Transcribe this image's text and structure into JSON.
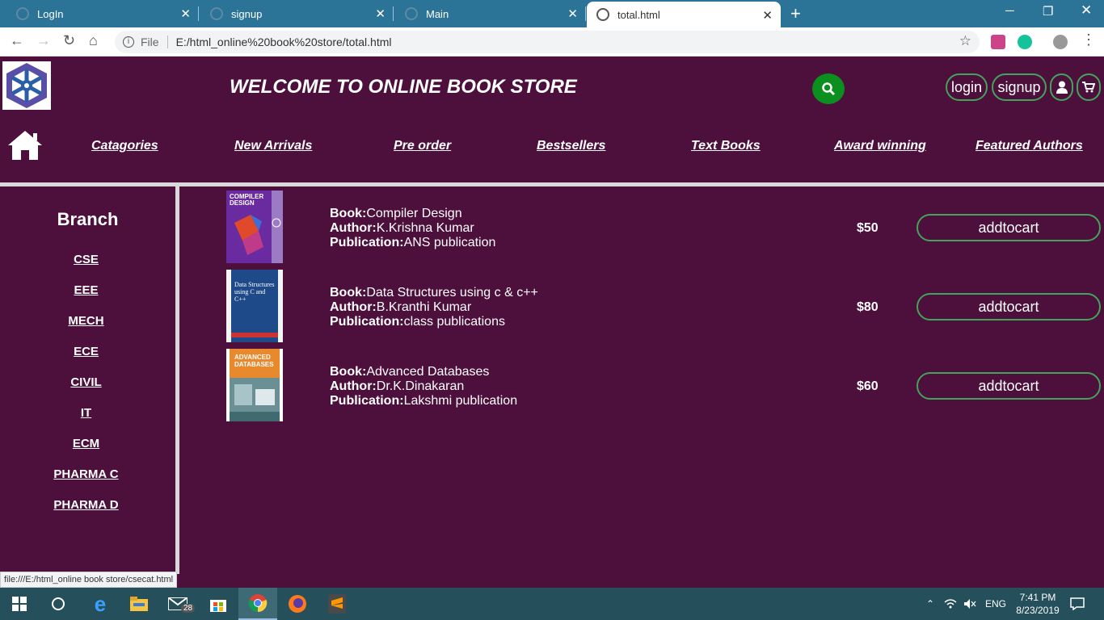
{
  "browser": {
    "tabs": [
      {
        "title": "LogIn"
      },
      {
        "title": "signup"
      },
      {
        "title": "Main"
      },
      {
        "title": "total.html"
      }
    ],
    "address": {
      "file_label": "File",
      "url": "E:/html_online%20book%20store/total.html"
    },
    "status_url": "file:///E:/html_online book store/csecat.html"
  },
  "header": {
    "title": "WELCOME TO ONLINE BOOK STORE",
    "login_label": "login",
    "signup_label": "signup"
  },
  "nav": {
    "items": [
      {
        "label": "Catagories"
      },
      {
        "label": "New Arrivals"
      },
      {
        "label": "Pre order"
      },
      {
        "label": "Bestsellers"
      },
      {
        "label": "Text Books"
      },
      {
        "label": "Award winning"
      },
      {
        "label": "Featured Authors"
      }
    ]
  },
  "sidebar": {
    "title": "Branch",
    "branches": [
      {
        "label": "CSE"
      },
      {
        "label": "EEE"
      },
      {
        "label": "MECH"
      },
      {
        "label": "ECE"
      },
      {
        "label": "CIVIL"
      },
      {
        "label": "IT"
      },
      {
        "label": "ECM"
      },
      {
        "label": "PHARMA C"
      },
      {
        "label": "PHARMA D"
      }
    ]
  },
  "books": {
    "field_labels": {
      "book": "Book:",
      "author": "Author:",
      "publication": "Publication:"
    },
    "add_label": "addtocart",
    "items": [
      {
        "book": "Compiler Design",
        "author": "K.Krishna Kumar",
        "publication": "ANS publication",
        "price": "$50",
        "cover_text": "COMPILER DESIGN"
      },
      {
        "book": "Data Structures using c & c++",
        "author": "B.Kranthi Kumar",
        "publication": "class publications",
        "price": "$80",
        "cover_text": "Data Structures using C and C++"
      },
      {
        "book": "Advanced Databases",
        "author": "Dr.K.Dinakaran",
        "publication": "Lakshmi publication",
        "price": "$60",
        "cover_text": "ADVANCED DATABASES"
      }
    ]
  },
  "taskbar": {
    "mail_badge": "28",
    "language": "ENG",
    "time": "7:41 PM",
    "date": "8/23/2019"
  },
  "colors": {
    "page_bg": "#4d0f3b",
    "accent_green": "#44a35a",
    "search_green": "#0b8f1e",
    "tab_bar": "#2c7497"
  }
}
